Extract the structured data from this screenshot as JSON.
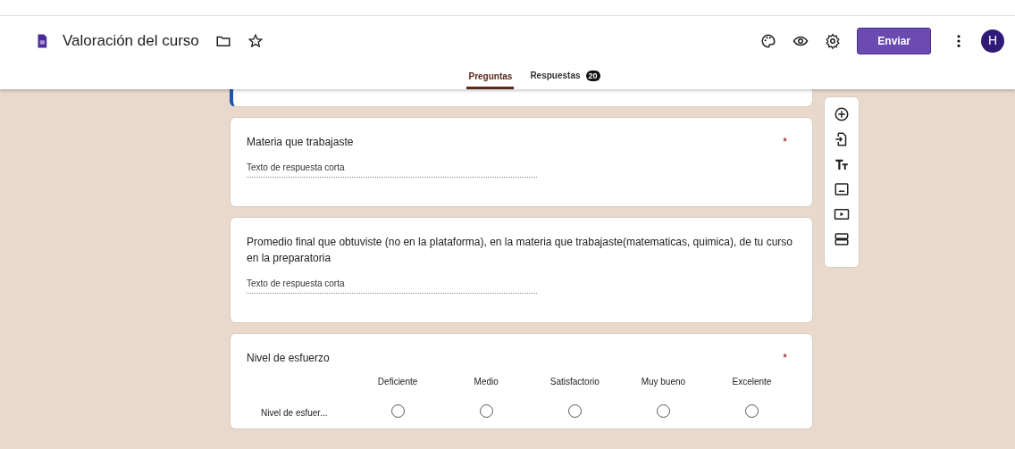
{
  "form": {
    "title": "Valoración del curso",
    "send_button": "Enviar",
    "avatar": "H"
  },
  "tabs": [
    {
      "label": "Preguntas",
      "selected": true
    },
    {
      "label": "Respuestas",
      "selected": false,
      "badge": "20"
    }
  ],
  "questions": [
    {
      "kind": "short",
      "title": "Materia que trabajaste",
      "required_mark": "*",
      "placeholder": "Texto de respuesta corta"
    },
    {
      "kind": "short",
      "title": "Promedio final que obtuviste (no en la plataforma), en la materia que trabajaste(matematicas, quimica), de tu curso en la preparatoria",
      "placeholder": "Texto de respuesta corta"
    },
    {
      "kind": "grid",
      "title": "Nivel de esfuerzo",
      "required_mark": "*",
      "columns": [
        "Deficiente",
        "Medio",
        "Satisfactorio",
        "Muy bueno",
        "Excelente"
      ],
      "rows": [
        {
          "label": "Nivel de esfuer...",
          "options": [
            {
              "selected": false
            },
            {
              "selected": false
            },
            {
              "selected": false
            },
            {
              "selected": false
            },
            {
              "selected": false
            }
          ]
        }
      ]
    }
  ]
}
